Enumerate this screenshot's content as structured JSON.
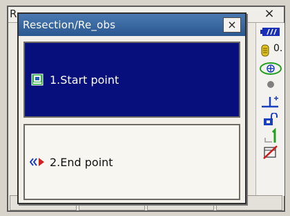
{
  "background_window": {
    "title_fragment": "R",
    "close_symbol": "×",
    "status_bar": {
      "zero_value": "0.",
      "icons": [
        "battery-icon",
        "target-constant-icon",
        "laser-target-icon",
        "circle-indicator-icon",
        "tilt-compensation-icon",
        "unlock-icon",
        "sequence-one-icon",
        "edit-disabled-icon"
      ]
    }
  },
  "dialog": {
    "title": "Resection/Re_obs",
    "close_symbol": "×",
    "options": [
      {
        "label": "1.Start point",
        "icon": "start-point-icon",
        "selected": true
      },
      {
        "label": "2.End point",
        "icon": "end-point-icon",
        "selected": false
      }
    ]
  },
  "colors": {
    "title_bar": "#2b5790",
    "selection": "#070f7d",
    "battery": "#1a2fb8"
  }
}
